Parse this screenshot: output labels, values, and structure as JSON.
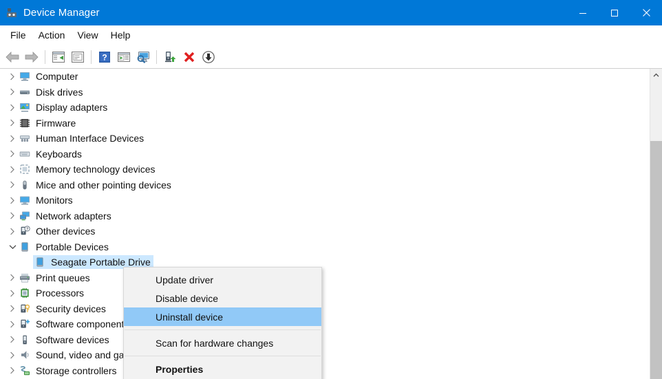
{
  "window": {
    "title": "Device Manager",
    "icon": "device-manager-icon",
    "titlebar_color": "#0078d7",
    "controls": [
      {
        "name": "minimize-button",
        "glyph": "minimize-icon",
        "label": "Minimize"
      },
      {
        "name": "maximize-button",
        "glyph": "maximize-icon",
        "label": "Maximize"
      },
      {
        "name": "close-button",
        "glyph": "close-icon",
        "label": "Close"
      }
    ]
  },
  "menubar": [
    {
      "label": "File"
    },
    {
      "label": "Action"
    },
    {
      "label": "View"
    },
    {
      "label": "Help"
    }
  ],
  "toolbar": [
    {
      "name": "back-button",
      "icon": "back-arrow-icon",
      "tooltip": "Back"
    },
    {
      "name": "forward-button",
      "icon": "forward-arrow-icon",
      "tooltip": "Forward"
    },
    {
      "name": "separator-1",
      "icon": "separator"
    },
    {
      "name": "show-hide-console-tree-button",
      "icon": "console-tree-icon",
      "tooltip": "Show/Hide Console Tree"
    },
    {
      "name": "properties-button",
      "icon": "properties-window-icon",
      "tooltip": "Properties"
    },
    {
      "name": "separator-2",
      "icon": "separator"
    },
    {
      "name": "help-button",
      "icon": "help-question-icon",
      "tooltip": "Help"
    },
    {
      "name": "enable-device-button",
      "icon": "window-play-icon",
      "tooltip": "Enable device"
    },
    {
      "name": "scan-for-hardware-changes-button",
      "icon": "monitor-scan-icon",
      "tooltip": "Scan for hardware changes"
    },
    {
      "name": "separator-3",
      "icon": "separator"
    },
    {
      "name": "update-driver-button",
      "icon": "device-update-green-icon",
      "tooltip": "Update driver"
    },
    {
      "name": "uninstall-device-button",
      "icon": "red-x-icon",
      "tooltip": "Uninstall device"
    },
    {
      "name": "disable-device-button",
      "icon": "circle-down-arrow-icon",
      "tooltip": "Disable device"
    }
  ],
  "tree": {
    "items": [
      {
        "label": "Computer",
        "icon": "monitor-icon",
        "indent": 0,
        "expander": "collapsed",
        "selected": false
      },
      {
        "label": "Disk drives",
        "icon": "disk-drive-icon",
        "indent": 0,
        "expander": "collapsed",
        "selected": false
      },
      {
        "label": "Display adapters",
        "icon": "display-adapter-icon",
        "indent": 0,
        "expander": "collapsed",
        "selected": false
      },
      {
        "label": "Firmware",
        "icon": "chip-icon",
        "indent": 0,
        "expander": "collapsed",
        "selected": false
      },
      {
        "label": "Human Interface Devices",
        "icon": "hid-icon",
        "indent": 0,
        "expander": "collapsed",
        "selected": false
      },
      {
        "label": "Keyboards",
        "icon": "keyboard-icon",
        "indent": 0,
        "expander": "collapsed",
        "selected": false
      },
      {
        "label": "Memory technology devices",
        "icon": "memory-card-icon",
        "indent": 0,
        "expander": "collapsed",
        "selected": false
      },
      {
        "label": "Mice and other pointing devices",
        "icon": "mouse-icon",
        "indent": 0,
        "expander": "collapsed",
        "selected": false
      },
      {
        "label": "Monitors",
        "icon": "monitor-screen-icon",
        "indent": 0,
        "expander": "collapsed",
        "selected": false
      },
      {
        "label": "Network adapters",
        "icon": "network-adapter-icon",
        "indent": 0,
        "expander": "collapsed",
        "selected": false
      },
      {
        "label": "Other devices",
        "icon": "unknown-device-icon",
        "indent": 0,
        "expander": "collapsed",
        "selected": false
      },
      {
        "label": "Portable Devices",
        "icon": "portable-device-icon",
        "indent": 0,
        "expander": "expanded",
        "selected": false
      },
      {
        "label": "Seagate Portable Drive",
        "icon": "portable-device-icon",
        "indent": 1,
        "expander": "none",
        "selected": true
      },
      {
        "label": "Print queues",
        "icon": "printer-icon",
        "indent": 0,
        "expander": "collapsed",
        "selected": false
      },
      {
        "label": "Processors",
        "icon": "processor-icon",
        "indent": 0,
        "expander": "collapsed",
        "selected": false
      },
      {
        "label": "Security devices",
        "icon": "security-device-icon",
        "indent": 0,
        "expander": "collapsed",
        "selected": false
      },
      {
        "label": "Software components",
        "icon": "software-component-icon",
        "indent": 0,
        "expander": "collapsed",
        "selected": false
      },
      {
        "label": "Software devices",
        "icon": "software-device-icon",
        "indent": 0,
        "expander": "collapsed",
        "selected": false
      },
      {
        "label": "Sound, video and game controllers",
        "icon": "speaker-icon",
        "indent": 0,
        "expander": "collapsed",
        "selected": false
      },
      {
        "label": "Storage controllers",
        "icon": "storage-controller-icon",
        "indent": 0,
        "expander": "collapsed",
        "selected": false
      }
    ],
    "selection_color": "#cce8ff"
  },
  "scrollbar": {
    "up_arrow": "chevron-up-icon",
    "thumb_color": "#c2c2c2",
    "track_color": "#f0f0f0"
  },
  "context_menu": {
    "highlight_color": "#91c9f7",
    "background_color": "#f2f2f2",
    "items": [
      {
        "label": "Update driver",
        "kind": "item",
        "highlighted": false,
        "bold": false
      },
      {
        "label": "Disable device",
        "kind": "item",
        "highlighted": false,
        "bold": false
      },
      {
        "label": "Uninstall device",
        "kind": "item",
        "highlighted": true,
        "bold": false
      },
      {
        "label": "",
        "kind": "separator"
      },
      {
        "label": "Scan for hardware changes",
        "kind": "item",
        "highlighted": false,
        "bold": false
      },
      {
        "label": "",
        "kind": "separator"
      },
      {
        "label": "Properties",
        "kind": "item",
        "highlighted": false,
        "bold": true
      }
    ]
  }
}
